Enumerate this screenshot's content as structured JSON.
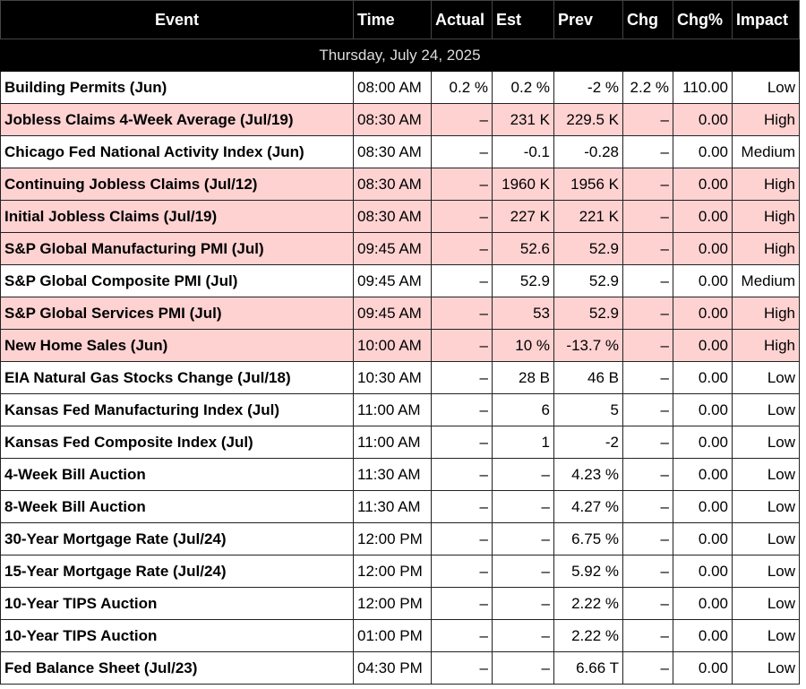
{
  "columns": [
    "Event",
    "Time",
    "Actual",
    "Est",
    "Prev",
    "Chg",
    "Chg%",
    "Impact"
  ],
  "date_label": "Thursday, July 24, 2025",
  "colors": {
    "header_bg": "#000000",
    "high_row_bg": "#ffd2d2",
    "normal_row_bg": "#ffffff"
  },
  "rows": [
    {
      "event": "Building Permits (Jun)",
      "time": "08:00 AM",
      "actual": "0.2 %",
      "est": "0.2 %",
      "prev": "-2 %",
      "chg": "2.2 %",
      "chg_pct": "110.00",
      "impact": "Low"
    },
    {
      "event": "Jobless Claims 4-Week Average (Jul/19)",
      "time": "08:30 AM",
      "actual": "–",
      "est": "231 K",
      "prev": "229.5 K",
      "chg": "–",
      "chg_pct": "0.00",
      "impact": "High"
    },
    {
      "event": "Chicago Fed National Activity Index (Jun)",
      "time": "08:30 AM",
      "actual": "–",
      "est": "-0.1",
      "prev": "-0.28",
      "chg": "–",
      "chg_pct": "0.00",
      "impact": "Medium"
    },
    {
      "event": "Continuing Jobless Claims (Jul/12)",
      "time": "08:30 AM",
      "actual": "–",
      "est": "1960 K",
      "prev": "1956 K",
      "chg": "–",
      "chg_pct": "0.00",
      "impact": "High"
    },
    {
      "event": "Initial Jobless Claims (Jul/19)",
      "time": "08:30 AM",
      "actual": "–",
      "est": "227 K",
      "prev": "221 K",
      "chg": "–",
      "chg_pct": "0.00",
      "impact": "High"
    },
    {
      "event": "S&P Global Manufacturing PMI (Jul)",
      "time": "09:45 AM",
      "actual": "–",
      "est": "52.6",
      "prev": "52.9",
      "chg": "–",
      "chg_pct": "0.00",
      "impact": "High"
    },
    {
      "event": "S&P Global Composite PMI (Jul)",
      "time": "09:45 AM",
      "actual": "–",
      "est": "52.9",
      "prev": "52.9",
      "chg": "–",
      "chg_pct": "0.00",
      "impact": "Medium"
    },
    {
      "event": "S&P Global Services PMI (Jul)",
      "time": "09:45 AM",
      "actual": "–",
      "est": "53",
      "prev": "52.9",
      "chg": "–",
      "chg_pct": "0.00",
      "impact": "High"
    },
    {
      "event": "New Home Sales (Jun)",
      "time": "10:00 AM",
      "actual": "–",
      "est": "10 %",
      "prev": "-13.7 %",
      "chg": "–",
      "chg_pct": "0.00",
      "impact": "High"
    },
    {
      "event": "EIA Natural Gas Stocks Change (Jul/18)",
      "time": "10:30 AM",
      "actual": "–",
      "est": "28 B",
      "prev": "46 B",
      "chg": "–",
      "chg_pct": "0.00",
      "impact": "Low"
    },
    {
      "event": "Kansas Fed Manufacturing Index (Jul)",
      "time": "11:00 AM",
      "actual": "–",
      "est": "6",
      "prev": "5",
      "chg": "–",
      "chg_pct": "0.00",
      "impact": "Low"
    },
    {
      "event": "Kansas Fed Composite Index (Jul)",
      "time": "11:00 AM",
      "actual": "–",
      "est": "1",
      "prev": "-2",
      "chg": "–",
      "chg_pct": "0.00",
      "impact": "Low"
    },
    {
      "event": "4-Week Bill Auction",
      "time": "11:30 AM",
      "actual": "–",
      "est": "–",
      "prev": "4.23 %",
      "chg": "–",
      "chg_pct": "0.00",
      "impact": "Low"
    },
    {
      "event": "8-Week Bill Auction",
      "time": "11:30 AM",
      "actual": "–",
      "est": "–",
      "prev": "4.27 %",
      "chg": "–",
      "chg_pct": "0.00",
      "impact": "Low"
    },
    {
      "event": "30-Year Mortgage Rate (Jul/24)",
      "time": "12:00 PM",
      "actual": "–",
      "est": "–",
      "prev": "6.75 %",
      "chg": "–",
      "chg_pct": "0.00",
      "impact": "Low"
    },
    {
      "event": "15-Year Mortgage Rate (Jul/24)",
      "time": "12:00 PM",
      "actual": "–",
      "est": "–",
      "prev": "5.92 %",
      "chg": "–",
      "chg_pct": "0.00",
      "impact": "Low"
    },
    {
      "event": "10-Year TIPS Auction",
      "time": "12:00 PM",
      "actual": "–",
      "est": "–",
      "prev": "2.22 %",
      "chg": "–",
      "chg_pct": "0.00",
      "impact": "Low"
    },
    {
      "event": "10-Year TIPS Auction",
      "time": "01:00 PM",
      "actual": "–",
      "est": "–",
      "prev": "2.22 %",
      "chg": "–",
      "chg_pct": "0.00",
      "impact": "Low"
    },
    {
      "event": "Fed Balance Sheet (Jul/23)",
      "time": "04:30 PM",
      "actual": "–",
      "est": "–",
      "prev": "6.66 T",
      "chg": "–",
      "chg_pct": "0.00",
      "impact": "Low"
    }
  ]
}
